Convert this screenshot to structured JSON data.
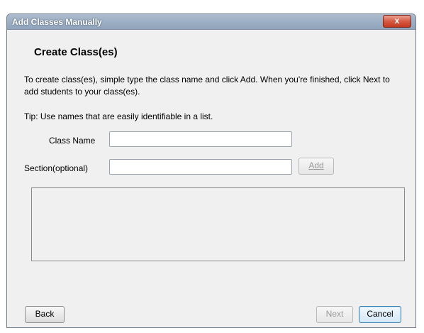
{
  "window": {
    "title": "Add Classes Manually",
    "close_label": "x"
  },
  "content": {
    "heading": "Create Class(es)",
    "description": "To create class(es), simple type the class name and click Add. When you're finished, click Next to add students to your class(es).",
    "tip": "Tip: Use names that are easily identifiable in a list."
  },
  "form": {
    "class_name_label": "Class Name",
    "class_name_value": "",
    "section_label": "Section(optional)",
    "section_value": "",
    "add_label": "Add"
  },
  "footer": {
    "back_label": "Back",
    "next_label": "Next",
    "cancel_label": "Cancel"
  },
  "colors": {
    "titlebar": "#9fb1c6",
    "close": "#d65a43",
    "dialog_bg": "#f0f0f0"
  }
}
